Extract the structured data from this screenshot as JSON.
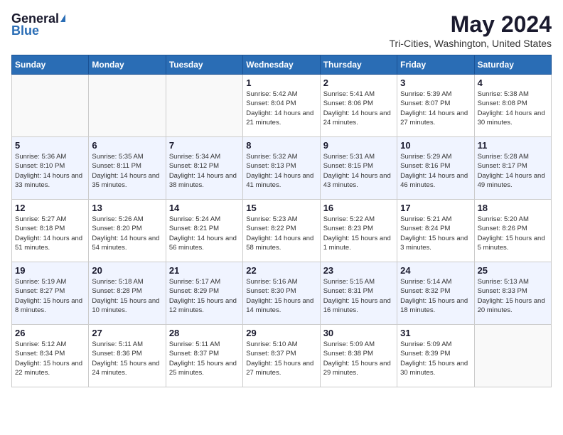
{
  "header": {
    "logo_general": "General",
    "logo_blue": "Blue",
    "month": "May 2024",
    "location": "Tri-Cities, Washington, United States"
  },
  "days_of_week": [
    "Sunday",
    "Monday",
    "Tuesday",
    "Wednesday",
    "Thursday",
    "Friday",
    "Saturday"
  ],
  "weeks": [
    [
      {
        "day": "",
        "sunrise": "",
        "sunset": "",
        "daylight": ""
      },
      {
        "day": "",
        "sunrise": "",
        "sunset": "",
        "daylight": ""
      },
      {
        "day": "",
        "sunrise": "",
        "sunset": "",
        "daylight": ""
      },
      {
        "day": "1",
        "sunrise": "Sunrise: 5:42 AM",
        "sunset": "Sunset: 8:04 PM",
        "daylight": "Daylight: 14 hours and 21 minutes."
      },
      {
        "day": "2",
        "sunrise": "Sunrise: 5:41 AM",
        "sunset": "Sunset: 8:06 PM",
        "daylight": "Daylight: 14 hours and 24 minutes."
      },
      {
        "day": "3",
        "sunrise": "Sunrise: 5:39 AM",
        "sunset": "Sunset: 8:07 PM",
        "daylight": "Daylight: 14 hours and 27 minutes."
      },
      {
        "day": "4",
        "sunrise": "Sunrise: 5:38 AM",
        "sunset": "Sunset: 8:08 PM",
        "daylight": "Daylight: 14 hours and 30 minutes."
      }
    ],
    [
      {
        "day": "5",
        "sunrise": "Sunrise: 5:36 AM",
        "sunset": "Sunset: 8:10 PM",
        "daylight": "Daylight: 14 hours and 33 minutes."
      },
      {
        "day": "6",
        "sunrise": "Sunrise: 5:35 AM",
        "sunset": "Sunset: 8:11 PM",
        "daylight": "Daylight: 14 hours and 35 minutes."
      },
      {
        "day": "7",
        "sunrise": "Sunrise: 5:34 AM",
        "sunset": "Sunset: 8:12 PM",
        "daylight": "Daylight: 14 hours and 38 minutes."
      },
      {
        "day": "8",
        "sunrise": "Sunrise: 5:32 AM",
        "sunset": "Sunset: 8:13 PM",
        "daylight": "Daylight: 14 hours and 41 minutes."
      },
      {
        "day": "9",
        "sunrise": "Sunrise: 5:31 AM",
        "sunset": "Sunset: 8:15 PM",
        "daylight": "Daylight: 14 hours and 43 minutes."
      },
      {
        "day": "10",
        "sunrise": "Sunrise: 5:29 AM",
        "sunset": "Sunset: 8:16 PM",
        "daylight": "Daylight: 14 hours and 46 minutes."
      },
      {
        "day": "11",
        "sunrise": "Sunrise: 5:28 AM",
        "sunset": "Sunset: 8:17 PM",
        "daylight": "Daylight: 14 hours and 49 minutes."
      }
    ],
    [
      {
        "day": "12",
        "sunrise": "Sunrise: 5:27 AM",
        "sunset": "Sunset: 8:18 PM",
        "daylight": "Daylight: 14 hours and 51 minutes."
      },
      {
        "day": "13",
        "sunrise": "Sunrise: 5:26 AM",
        "sunset": "Sunset: 8:20 PM",
        "daylight": "Daylight: 14 hours and 54 minutes."
      },
      {
        "day": "14",
        "sunrise": "Sunrise: 5:24 AM",
        "sunset": "Sunset: 8:21 PM",
        "daylight": "Daylight: 14 hours and 56 minutes."
      },
      {
        "day": "15",
        "sunrise": "Sunrise: 5:23 AM",
        "sunset": "Sunset: 8:22 PM",
        "daylight": "Daylight: 14 hours and 58 minutes."
      },
      {
        "day": "16",
        "sunrise": "Sunrise: 5:22 AM",
        "sunset": "Sunset: 8:23 PM",
        "daylight": "Daylight: 15 hours and 1 minute."
      },
      {
        "day": "17",
        "sunrise": "Sunrise: 5:21 AM",
        "sunset": "Sunset: 8:24 PM",
        "daylight": "Daylight: 15 hours and 3 minutes."
      },
      {
        "day": "18",
        "sunrise": "Sunrise: 5:20 AM",
        "sunset": "Sunset: 8:26 PM",
        "daylight": "Daylight: 15 hours and 5 minutes."
      }
    ],
    [
      {
        "day": "19",
        "sunrise": "Sunrise: 5:19 AM",
        "sunset": "Sunset: 8:27 PM",
        "daylight": "Daylight: 15 hours and 8 minutes."
      },
      {
        "day": "20",
        "sunrise": "Sunrise: 5:18 AM",
        "sunset": "Sunset: 8:28 PM",
        "daylight": "Daylight: 15 hours and 10 minutes."
      },
      {
        "day": "21",
        "sunrise": "Sunrise: 5:17 AM",
        "sunset": "Sunset: 8:29 PM",
        "daylight": "Daylight: 15 hours and 12 minutes."
      },
      {
        "day": "22",
        "sunrise": "Sunrise: 5:16 AM",
        "sunset": "Sunset: 8:30 PM",
        "daylight": "Daylight: 15 hours and 14 minutes."
      },
      {
        "day": "23",
        "sunrise": "Sunrise: 5:15 AM",
        "sunset": "Sunset: 8:31 PM",
        "daylight": "Daylight: 15 hours and 16 minutes."
      },
      {
        "day": "24",
        "sunrise": "Sunrise: 5:14 AM",
        "sunset": "Sunset: 8:32 PM",
        "daylight": "Daylight: 15 hours and 18 minutes."
      },
      {
        "day": "25",
        "sunrise": "Sunrise: 5:13 AM",
        "sunset": "Sunset: 8:33 PM",
        "daylight": "Daylight: 15 hours and 20 minutes."
      }
    ],
    [
      {
        "day": "26",
        "sunrise": "Sunrise: 5:12 AM",
        "sunset": "Sunset: 8:34 PM",
        "daylight": "Daylight: 15 hours and 22 minutes."
      },
      {
        "day": "27",
        "sunrise": "Sunrise: 5:11 AM",
        "sunset": "Sunset: 8:36 PM",
        "daylight": "Daylight: 15 hours and 24 minutes."
      },
      {
        "day": "28",
        "sunrise": "Sunrise: 5:11 AM",
        "sunset": "Sunset: 8:37 PM",
        "daylight": "Daylight: 15 hours and 25 minutes."
      },
      {
        "day": "29",
        "sunrise": "Sunrise: 5:10 AM",
        "sunset": "Sunset: 8:37 PM",
        "daylight": "Daylight: 15 hours and 27 minutes."
      },
      {
        "day": "30",
        "sunrise": "Sunrise: 5:09 AM",
        "sunset": "Sunset: 8:38 PM",
        "daylight": "Daylight: 15 hours and 29 minutes."
      },
      {
        "day": "31",
        "sunrise": "Sunrise: 5:09 AM",
        "sunset": "Sunset: 8:39 PM",
        "daylight": "Daylight: 15 hours and 30 minutes."
      },
      {
        "day": "",
        "sunrise": "",
        "sunset": "",
        "daylight": ""
      }
    ]
  ]
}
